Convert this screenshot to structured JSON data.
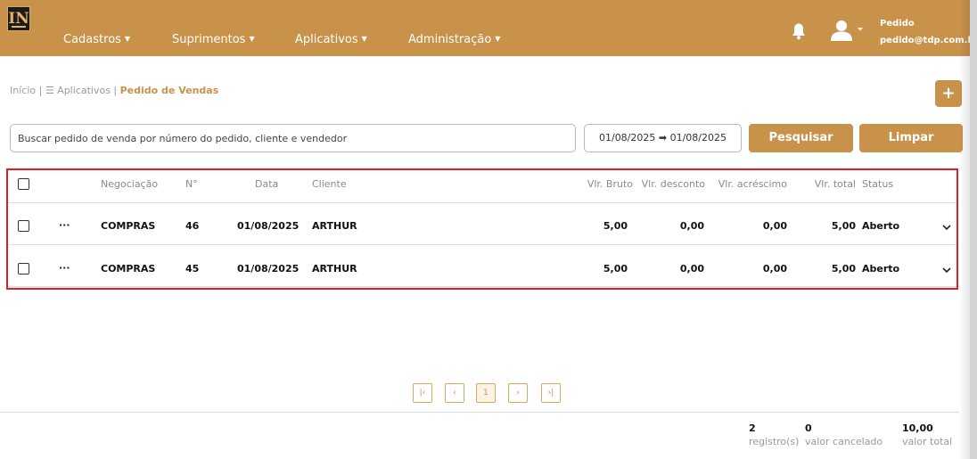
{
  "header": {
    "logo_text": "IN",
    "menu": [
      {
        "label": "Cadastros"
      },
      {
        "label": "Suprimentos"
      },
      {
        "label": "Aplicativos"
      },
      {
        "label": "Administração"
      }
    ],
    "user_name": "Pedido",
    "user_email": "pedido@tdp.com.br",
    "icons": {
      "notifications": "bell-icon",
      "user": "user-icon"
    }
  },
  "breadcrumb": {
    "home": "Início |",
    "apps": "☰ Aplicativos |",
    "current": "Pedido de Vendas"
  },
  "add_button": "+",
  "search": {
    "placeholder": "Buscar pedido de venda por número do pedido, cliente e vendedor",
    "date_range": "01/08/2025 ➡ 01/08/2025",
    "search_label": "Pesquisar",
    "clear_label": "Limpar"
  },
  "table": {
    "columns": {
      "negociacao": "Negociação",
      "numero": "N°",
      "data": "Data",
      "cliente": "Cliente",
      "vlr_bruto": "Vlr. Bruto",
      "vlr_desconto": "Vlr. desconto",
      "vlr_acrescimo": "Vlr. acréscimo",
      "vlr_total": "Vlr. total",
      "status": "Status"
    },
    "rows": [
      {
        "menu": "···",
        "negociacao": "COMPRAS",
        "numero": "46",
        "data": "01/08/2025",
        "cliente": "ARTHUR",
        "vlr_bruto": "5,00",
        "vlr_desconto": "0,00",
        "vlr_acrescimo": "0,00",
        "vlr_total": "5,00",
        "status": "Aberto"
      },
      {
        "menu": "···",
        "negociacao": "COMPRAS",
        "numero": "45",
        "data": "01/08/2025",
        "cliente": "ARTHUR",
        "vlr_bruto": "5,00",
        "vlr_desconto": "0,00",
        "vlr_acrescimo": "0,00",
        "vlr_total": "5,00",
        "status": "Aberto"
      }
    ]
  },
  "pagination": {
    "first": "|‹",
    "prev": "‹",
    "current": "1",
    "next": "›",
    "last": "›|"
  },
  "summary": {
    "registros_value": "2",
    "registros_label": "registro(s)",
    "cancelado_value": "0",
    "cancelado_label": "valor cancelado",
    "total_value": "10,00",
    "total_label": "valor total"
  },
  "colors": {
    "brand": "#c9924a",
    "highlight_border": "#e02020"
  }
}
